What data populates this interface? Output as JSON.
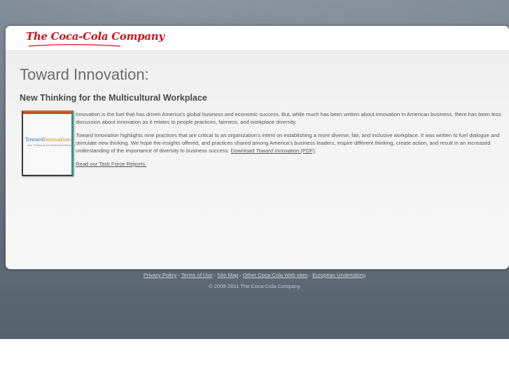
{
  "header": {
    "logo_text": "The Coca-Cola Company"
  },
  "main": {
    "title": "Toward Innovation:",
    "subtitle": "New Thinking for the Multicultural Workplace",
    "book_cover": {
      "title_part1": "Toward",
      "title_part2": "Innovation:",
      "subtitle": "New Thinking for the Multicultural Workplace"
    },
    "paragraph1": "Innovation is the fuel that has driven America's global business and economic success. But, while much has been written about innovation in American business, there has been less discussion about innovation as it relates to people practices, fairness, and workplace diversity.",
    "paragraph2": {
      "lead_italic": "Toward Innovation",
      "text": " highlights nine practices that are critical to an organization's intent on establishing a more diverse, fair, and inclusive workplace. It was written to fuel dialogue and stimulate new thinking. We hope the insights offered, and practices shared among America's business leaders, inspire different thinking, create action, and result in an increased understanding of the importance of diversity to business success. ",
      "download_prefix": "Download ",
      "download_italic": "Toward Innovation",
      "download_suffix": " (PDF)",
      "end": "."
    },
    "task_force_link": "Read our Task Force Reports."
  },
  "footer": {
    "links": [
      "Privacy Policy",
      "Terms of Use",
      "Site Map",
      "Other Coca-Cola Web sites",
      "European Undertaking"
    ],
    "separator": " - ",
    "copyright": "© 2008-2011 The Coca-Cola Company"
  },
  "colors": {
    "brand_red": "#d2111b",
    "backdrop": "#6a7782"
  }
}
